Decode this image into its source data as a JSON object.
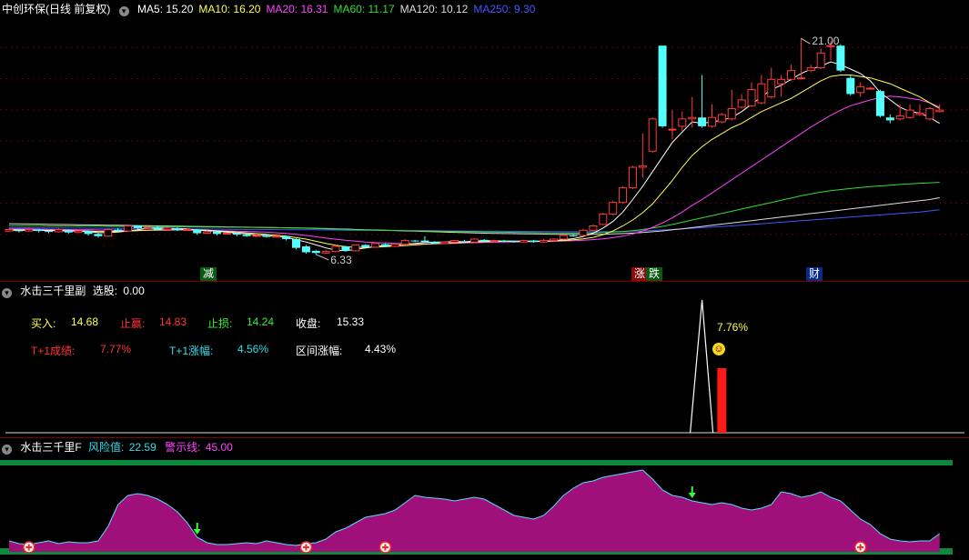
{
  "header": {
    "stock_title": "中创环保(日线 前复权)",
    "ma": [
      {
        "label": "MA5:",
        "value": "15.20",
        "color": "#ffffff"
      },
      {
        "label": "MA10:",
        "value": "16.20",
        "color": "#ffff55"
      },
      {
        "label": "MA20:",
        "value": "16.31",
        "color": "#ff44ff"
      },
      {
        "label": "MA60:",
        "value": "11.17",
        "color": "#33dd33"
      },
      {
        "label": "MA120:",
        "value": "10.12",
        "color": "#dddddd"
      },
      {
        "label": "MA250:",
        "value": "9.30",
        "color": "#4455ff"
      }
    ]
  },
  "main_chart": {
    "high_label": "21.00",
    "low_label": "6.33",
    "flags": {
      "reduce": "减",
      "limit_up": "涨",
      "fall": "跌",
      "finance": "财"
    }
  },
  "sub_panel": {
    "title": "水击三千里副",
    "select_label": "选股:",
    "select_value": "0.00",
    "buy_label": "买入:",
    "buy_value": "14.68",
    "profit_label": "止赢:",
    "profit_value": "14.83",
    "stop_label": "止损:",
    "stop_value": "14.24",
    "close_label": "收盘:",
    "close_value": "15.33",
    "t1_result_label": "T+1成绩:",
    "t1_result_value": "7.77%",
    "t1_rise_label": "T+1涨幅:",
    "t1_rise_value": "4.56%",
    "range_label": "区间涨幅:",
    "range_value": "4.43%",
    "peak_label": "7.76%"
  },
  "risk_panel": {
    "title": "水击三千里F",
    "risk_label": "风险值:",
    "risk_value": "22.59",
    "warn_label": "警示线:",
    "warn_value": "45.00"
  },
  "chart_data": {
    "type": "candlestick",
    "y_range": [
      5.5,
      22.5
    ],
    "candles": [
      [
        7.85,
        7.95,
        8.05,
        7.8
      ],
      [
        7.9,
        7.85,
        8.0,
        7.75
      ],
      [
        7.85,
        7.95,
        8.1,
        7.8
      ],
      [
        7.95,
        7.85,
        8.0,
        7.75
      ],
      [
        7.85,
        7.8,
        7.95,
        7.7
      ],
      [
        7.8,
        7.95,
        8.05,
        7.75
      ],
      [
        7.9,
        7.75,
        7.95,
        7.65
      ],
      [
        7.75,
        7.85,
        7.9,
        7.7
      ],
      [
        7.85,
        7.65,
        7.9,
        7.55
      ],
      [
        7.65,
        7.5,
        7.7,
        7.4
      ],
      [
        7.5,
        7.95,
        8.0,
        7.45
      ],
      [
        7.95,
        7.85,
        8.05,
        7.8
      ],
      [
        7.85,
        8.2,
        8.3,
        7.8
      ],
      [
        8.2,
        8.05,
        8.25,
        7.95
      ],
      [
        8.05,
        8.1,
        8.2,
        8.0
      ],
      [
        8.1,
        7.95,
        8.2,
        7.9
      ],
      [
        7.95,
        8.05,
        8.15,
        7.9
      ],
      [
        8.05,
        7.9,
        8.1,
        7.85
      ],
      [
        7.9,
        7.95,
        8.05,
        7.85
      ],
      [
        7.95,
        7.7,
        8.0,
        7.6
      ],
      [
        7.7,
        7.8,
        7.9,
        7.65
      ],
      [
        7.8,
        7.65,
        7.85,
        7.55
      ],
      [
        7.65,
        7.7,
        7.75,
        7.6
      ],
      [
        7.7,
        7.6,
        7.75,
        7.5
      ],
      [
        7.6,
        7.5,
        7.65,
        7.45
      ],
      [
        7.5,
        7.55,
        7.6,
        7.45
      ],
      [
        7.55,
        7.45,
        7.6,
        7.4
      ],
      [
        7.45,
        7.5,
        7.55,
        7.4
      ],
      [
        7.5,
        7.3,
        7.5,
        7.2
      ],
      [
        7.3,
        6.7,
        7.35,
        6.6
      ],
      [
        6.8,
        6.4,
        6.9,
        6.3
      ],
      [
        6.5,
        6.35,
        6.55,
        6.25
      ],
      [
        6.35,
        6.45,
        6.55,
        6.33
      ],
      [
        6.45,
        6.8,
        6.9,
        6.4
      ],
      [
        6.8,
        6.5,
        6.85,
        6.45
      ],
      [
        6.5,
        6.9,
        6.95,
        6.45
      ],
      [
        6.9,
        6.75,
        6.95,
        6.65
      ],
      [
        6.75,
        7.0,
        7.05,
        6.7
      ],
      [
        6.95,
        6.8,
        7.0,
        6.75
      ],
      [
        6.8,
        6.95,
        7.0,
        6.75
      ],
      [
        6.95,
        7.2,
        7.3,
        6.9
      ],
      [
        7.2,
        7.15,
        7.25,
        7.1
      ],
      [
        7.2,
        7.1,
        7.5,
        7.05
      ],
      [
        7.1,
        7.0,
        7.15,
        6.95
      ],
      [
        7.0,
        7.1,
        7.15,
        6.95
      ],
      [
        7.1,
        7.2,
        7.25,
        7.05
      ],
      [
        7.15,
        7.1,
        7.25,
        7.05
      ],
      [
        7.1,
        7.3,
        7.35,
        7.05
      ],
      [
        7.25,
        7.15,
        7.3,
        7.1
      ],
      [
        7.15,
        7.2,
        7.25,
        7.1
      ],
      [
        7.2,
        7.15,
        7.25,
        7.1
      ],
      [
        7.15,
        7.1,
        7.2,
        7.05
      ],
      [
        7.1,
        7.2,
        7.25,
        7.05
      ],
      [
        7.2,
        7.1,
        7.25,
        7.05
      ],
      [
        7.1,
        7.2,
        7.3,
        7.05
      ],
      [
        7.2,
        7.3,
        7.35,
        7.15
      ],
      [
        7.3,
        7.55,
        7.6,
        7.25
      ],
      [
        7.55,
        7.5,
        7.65,
        7.45
      ],
      [
        7.55,
        7.9,
        8.0,
        7.5
      ],
      [
        7.9,
        8.2,
        8.3,
        7.85
      ],
      [
        8.3,
        9.0,
        9.1,
        8.25
      ],
      [
        9.0,
        9.8,
        9.9,
        8.95
      ],
      [
        9.8,
        10.8,
        10.9,
        9.7
      ],
      [
        10.8,
        12.2,
        12.3,
        10.7
      ],
      [
        12.2,
        12.3,
        14.5,
        11.5
      ],
      [
        13.3,
        15.5,
        15.6,
        13.2
      ],
      [
        20.5,
        15.0,
        20.5,
        14.9
      ],
      [
        14.8,
        14.8,
        16.1,
        14.1
      ],
      [
        15.0,
        15.5,
        16.0,
        14.7
      ],
      [
        15.5,
        15.6,
        17.0,
        14.9
      ],
      [
        15.6,
        15.0,
        18.5,
        14.9
      ],
      [
        15.0,
        15.6,
        16.5,
        14.9
      ],
      [
        15.3,
        15.8,
        15.9,
        15.2
      ],
      [
        15.5,
        16.2,
        17.5,
        15.4
      ],
      [
        16.3,
        16.8,
        17.2,
        16.2
      ],
      [
        16.4,
        17.5,
        18.0,
        16.3
      ],
      [
        16.6,
        17.9,
        18.5,
        16.5
      ],
      [
        17.0,
        18.2,
        19.0,
        16.9
      ],
      [
        17.9,
        18.2,
        18.5,
        17.0
      ],
      [
        18.2,
        18.8,
        19.2,
        18.1
      ],
      [
        18.3,
        18.3,
        21.0,
        18.2
      ],
      [
        18.8,
        19.0,
        19.2,
        18.7
      ],
      [
        19.0,
        20.0,
        20.3,
        18.9
      ],
      [
        20.5,
        20.5,
        20.8,
        19.5
      ],
      [
        20.5,
        18.8,
        20.6,
        18.7
      ],
      [
        18.3,
        17.2,
        18.5,
        17.1
      ],
      [
        17.3,
        17.7,
        18.0,
        17.0
      ],
      [
        17.6,
        17.6,
        17.7,
        17.5
      ],
      [
        17.4,
        15.7,
        17.5,
        15.6
      ],
      [
        15.6,
        15.4,
        15.8,
        15.2
      ],
      [
        15.5,
        15.7,
        16.5,
        15.4
      ],
      [
        15.6,
        16.1,
        16.5,
        15.5
      ],
      [
        15.8,
        15.9,
        16.5,
        15.7
      ],
      [
        15.5,
        16.2,
        16.3,
        15.4
      ],
      [
        16.0,
        16.1,
        16.5,
        15.95
      ]
    ],
    "ma5": [
      7.9,
      7.9,
      7.9,
      7.9,
      7.88,
      7.87,
      7.86,
      7.84,
      7.81,
      7.74,
      7.75,
      7.78,
      7.85,
      7.93,
      8.05,
      8.06,
      8.05,
      8.02,
      7.99,
      7.9,
      7.87,
      7.83,
      7.77,
      7.71,
      7.65,
      7.58,
      7.55,
      7.48,
      7.42,
      7.26,
      7.1,
      6.9,
      6.7,
      6.55,
      6.5,
      6.6,
      6.7,
      6.8,
      6.85,
      6.9,
      6.95,
      7.0,
      7.07,
      7.1,
      7.11,
      7.13,
      7.12,
      7.16,
      7.19,
      7.18,
      7.17,
      7.16,
      7.15,
      7.15,
      7.15,
      7.18,
      7.26,
      7.33,
      7.48,
      7.7,
      8.05,
      8.5,
      9.15,
      10.0,
      10.9,
      11.9,
      12.9,
      13.9,
      14.6,
      15.3,
      15.2,
      15.3,
      15.4,
      15.6,
      16.0,
      16.5,
      17.0,
      17.5,
      17.8,
      18.2,
      18.6,
      18.9,
      19.1,
      19.4,
      19.2,
      18.9,
      18.6,
      18.1,
      17.3,
      16.8,
      16.3,
      16.0,
      15.9,
      15.6,
      15.2
    ],
    "ma10": [
      7.95,
      7.94,
      7.93,
      7.92,
      7.91,
      7.9,
      7.89,
      7.87,
      7.85,
      7.82,
      7.82,
      7.83,
      7.85,
      7.87,
      7.9,
      7.92,
      7.93,
      7.95,
      7.96,
      7.94,
      7.9,
      7.86,
      7.82,
      7.78,
      7.73,
      7.68,
      7.62,
      7.56,
      7.5,
      7.4,
      7.3,
      7.15,
      7.0,
      6.88,
      6.78,
      6.75,
      6.72,
      6.75,
      6.78,
      6.82,
      6.86,
      6.9,
      6.95,
      6.99,
      7.02,
      7.05,
      7.07,
      7.1,
      7.12,
      7.14,
      7.15,
      7.15,
      7.15,
      7.16,
      7.16,
      7.18,
      7.2,
      7.25,
      7.32,
      7.42,
      7.6,
      7.85,
      8.2,
      8.6,
      9.1,
      9.7,
      10.5,
      11.3,
      12.2,
      13.0,
      13.6,
      14.1,
      14.5,
      14.9,
      15.2,
      15.6,
      16.0,
      16.3,
      16.6,
      16.9,
      17.3,
      17.7,
      18.1,
      18.4,
      18.5,
      18.5,
      18.4,
      18.3,
      18.1,
      17.9,
      17.6,
      17.3,
      17.0,
      16.6,
      16.2
    ],
    "ma20": [
      8.0,
      8.0,
      7.99,
      7.98,
      7.97,
      7.96,
      7.95,
      7.94,
      7.93,
      7.92,
      7.91,
      7.9,
      7.9,
      7.9,
      7.9,
      7.9,
      7.91,
      7.92,
      7.92,
      7.91,
      7.9,
      7.88,
      7.86,
      7.84,
      7.82,
      7.8,
      7.77,
      7.73,
      7.69,
      7.62,
      7.55,
      7.46,
      7.37,
      7.29,
      7.22,
      7.16,
      7.1,
      7.06,
      7.03,
      7.0,
      6.98,
      6.97,
      6.97,
      6.98,
      6.99,
      7.01,
      7.03,
      7.05,
      7.07,
      7.09,
      7.1,
      7.11,
      7.12,
      7.13,
      7.14,
      7.15,
      7.17,
      7.19,
      7.22,
      7.26,
      7.32,
      7.4,
      7.5,
      7.65,
      7.85,
      8.1,
      8.4,
      8.75,
      9.15,
      9.6,
      10.0,
      10.45,
      10.9,
      11.35,
      11.8,
      12.25,
      12.7,
      13.15,
      13.6,
      14.05,
      14.5,
      14.95,
      15.35,
      15.75,
      16.1,
      16.4,
      16.6,
      16.8,
      16.95,
      17.05,
      17.0,
      16.9,
      16.8,
      16.6,
      16.31
    ],
    "ma60": [
      8.22,
      8.22,
      8.21,
      8.21,
      8.2,
      8.2,
      8.19,
      8.19,
      8.18,
      8.18,
      8.17,
      8.17,
      8.16,
      8.16,
      8.15,
      8.15,
      8.14,
      8.14,
      8.13,
      8.13,
      8.12,
      8.12,
      8.11,
      8.11,
      8.1,
      8.1,
      8.09,
      8.08,
      8.07,
      8.06,
      8.04,
      8.02,
      8.0,
      7.98,
      7.96,
      7.94,
      7.92,
      7.9,
      7.89,
      7.88,
      7.87,
      7.86,
      7.85,
      7.84,
      7.83,
      7.82,
      7.81,
      7.8,
      7.79,
      7.78,
      7.77,
      7.76,
      7.75,
      7.74,
      7.73,
      7.72,
      7.72,
      7.72,
      7.72,
      7.73,
      7.75,
      7.78,
      7.82,
      7.87,
      7.95,
      8.05,
      8.17,
      8.3,
      8.45,
      8.6,
      8.75,
      8.9,
      9.05,
      9.2,
      9.35,
      9.5,
      9.65,
      9.8,
      9.95,
      10.1,
      10.25,
      10.38,
      10.5,
      10.6,
      10.68,
      10.75,
      10.82,
      10.88,
      10.93,
      10.98,
      11.03,
      11.07,
      11.11,
      11.14,
      11.17
    ],
    "ma120": [
      8.35,
      8.34,
      8.33,
      8.32,
      8.31,
      8.3,
      8.29,
      8.28,
      8.27,
      8.26,
      8.25,
      8.24,
      8.23,
      8.22,
      8.21,
      8.2,
      8.19,
      8.18,
      8.17,
      8.16,
      8.15,
      8.14,
      8.13,
      8.12,
      8.11,
      8.1,
      8.09,
      8.08,
      8.07,
      8.06,
      8.05,
      8.04,
      8.02,
      8.0,
      7.98,
      7.96,
      7.94,
      7.92,
      7.9,
      7.88,
      7.86,
      7.84,
      7.82,
      7.8,
      7.78,
      7.76,
      7.74,
      7.72,
      7.7,
      7.69,
      7.68,
      7.67,
      7.66,
      7.65,
      7.64,
      7.63,
      7.62,
      7.62,
      7.62,
      7.62,
      7.63,
      7.65,
      7.68,
      7.71,
      7.75,
      7.8,
      7.86,
      7.93,
      8.0,
      8.08,
      8.16,
      8.24,
      8.32,
      8.4,
      8.48,
      8.56,
      8.64,
      8.72,
      8.8,
      8.88,
      8.96,
      9.04,
      9.12,
      9.2,
      9.28,
      9.36,
      9.44,
      9.52,
      9.6,
      9.68,
      9.76,
      9.84,
      9.92,
      10.0,
      10.12
    ],
    "ma250": [
      8.08,
      8.08,
      8.07,
      8.07,
      8.06,
      8.06,
      8.05,
      8.05,
      8.04,
      8.04,
      8.03,
      8.03,
      8.02,
      8.02,
      8.01,
      8.01,
      8.0,
      8.0,
      7.99,
      7.99,
      7.98,
      7.98,
      7.97,
      7.97,
      7.96,
      7.96,
      7.95,
      7.95,
      7.94,
      7.94,
      7.93,
      7.93,
      7.92,
      7.92,
      7.91,
      7.91,
      7.9,
      7.9,
      7.89,
      7.89,
      7.88,
      7.88,
      7.87,
      7.87,
      7.86,
      7.86,
      7.85,
      7.85,
      7.84,
      7.84,
      7.83,
      7.83,
      7.82,
      7.82,
      7.81,
      7.81,
      7.8,
      7.8,
      7.8,
      7.8,
      7.8,
      7.81,
      7.82,
      7.84,
      7.86,
      7.89,
      7.92,
      7.96,
      8.0,
      8.04,
      8.08,
      8.12,
      8.16,
      8.2,
      8.25,
      8.3,
      8.35,
      8.4,
      8.45,
      8.5,
      8.55,
      8.6,
      8.65,
      8.7,
      8.75,
      8.8,
      8.85,
      8.9,
      8.95,
      9.0,
      9.05,
      9.1,
      9.15,
      9.22,
      9.3
    ],
    "signal_spike": {
      "index": 70,
      "value": 7.76
    },
    "red_bar_index": 72,
    "risk_range": [
      0,
      100
    ],
    "risk_values": [
      12,
      9,
      8,
      10,
      12,
      9,
      11,
      10,
      10,
      12,
      28,
      52,
      62,
      64,
      62,
      58,
      52,
      44,
      32,
      16,
      10,
      8,
      8,
      9,
      10,
      9,
      12,
      10,
      8,
      7,
      9,
      10,
      14,
      22,
      26,
      32,
      38,
      40,
      42,
      46,
      54,
      62,
      60,
      59,
      58,
      56,
      58,
      60,
      58,
      52,
      46,
      40,
      38,
      36,
      40,
      50,
      62,
      70,
      76,
      78,
      82,
      84,
      86,
      88,
      90,
      80,
      68,
      62,
      60,
      56,
      54,
      52,
      54,
      52,
      48,
      46,
      48,
      52,
      66,
      64,
      60,
      62,
      66,
      60,
      56,
      46,
      36,
      30,
      20,
      14,
      12,
      11,
      12,
      12,
      20
    ],
    "risk_warn": 100,
    "buy_marker_indices": [
      2,
      30,
      38,
      86
    ],
    "sell_marker_indices": [
      19,
      69
    ]
  }
}
